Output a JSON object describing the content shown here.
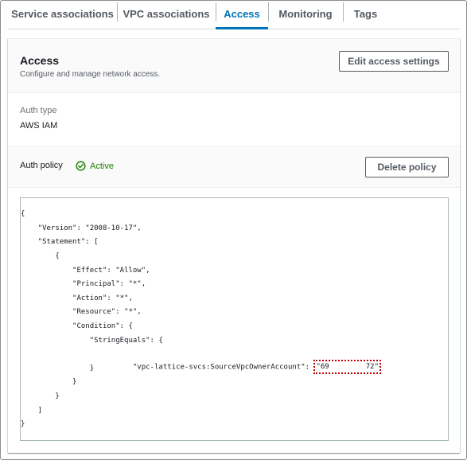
{
  "tabs": [
    {
      "label": "Service associations",
      "active": false
    },
    {
      "label": "VPC associations",
      "active": false
    },
    {
      "label": "Access",
      "active": true
    },
    {
      "label": "Monitoring",
      "active": false
    },
    {
      "label": "Tags",
      "active": false
    }
  ],
  "access": {
    "title": "Access",
    "description": "Configure and manage network access.",
    "edit_button": "Edit access settings"
  },
  "auth_type": {
    "label": "Auth type",
    "value": "AWS IAM"
  },
  "auth_policy": {
    "label": "Auth policy",
    "status": "Active",
    "status_icon": "check-circle-icon",
    "status_color": "#1d8102",
    "delete_button": "Delete policy"
  },
  "policy_code": {
    "lines": [
      "{",
      "    \"Version\": \"2008-10-17\",",
      "    \"Statement\": [",
      "        {",
      "            \"Effect\": \"Allow\",",
      "            \"Principal\": \"*\",",
      "            \"Action\": \"*\",",
      "            \"Resource\": \"*\",",
      "            \"Condition\": {",
      "                \"StringEquals\": {",
      "                    \"vpc-lattice-svcs:SourceVpcOwnerAccount\": ",
      "                }",
      "            }",
      "        }",
      "    ]",
      "}"
    ],
    "redacted_prefix": "\"69",
    "redacted_suffix": "72\""
  },
  "colors": {
    "accent": "#0073bb",
    "active_status": "#1d8102",
    "redaction_border": "#c00000"
  }
}
